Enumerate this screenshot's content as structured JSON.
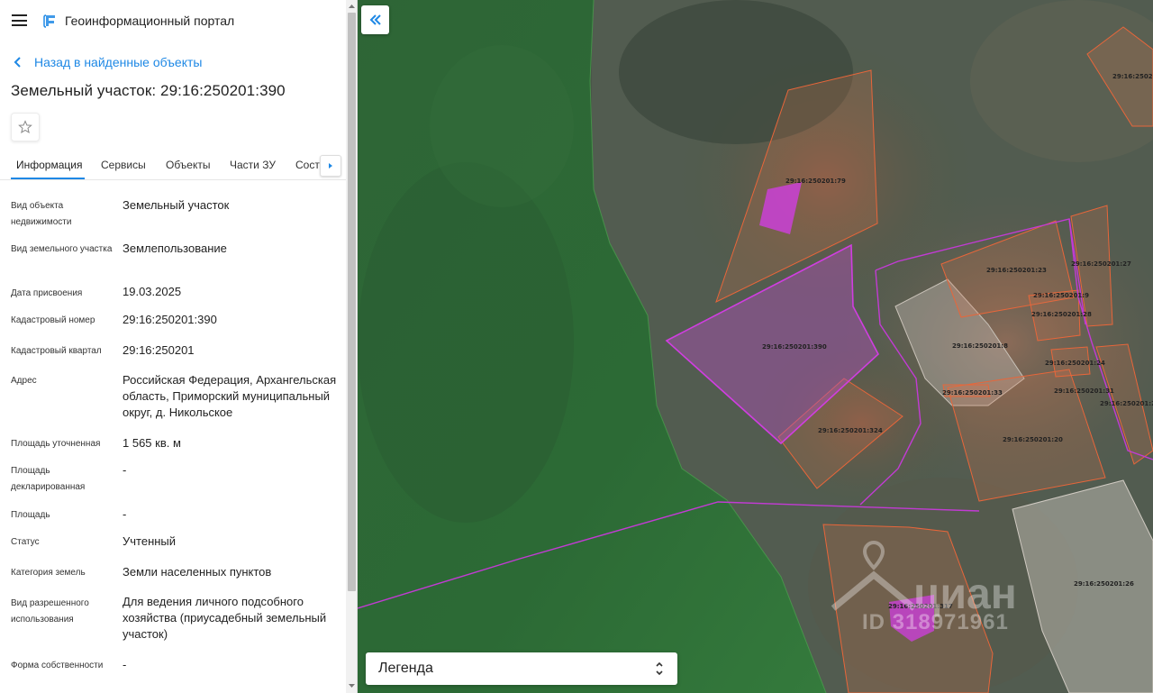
{
  "header": {
    "app_title": "Геоинформационный портал",
    "menu_icon": "hamburger-menu-icon",
    "logo_icon": "portal-logo-icon"
  },
  "nav": {
    "back_label": "Назад в найденные объекты"
  },
  "object": {
    "title": "Земельный участок: 29:16:250201:390"
  },
  "tabs": [
    {
      "label": "Информация",
      "active": true
    },
    {
      "label": "Сервисы",
      "active": false
    },
    {
      "label": "Объекты",
      "active": false
    },
    {
      "label": "Части ЗУ",
      "active": false
    },
    {
      "label": "Соста",
      "active": false
    }
  ],
  "properties": [
    {
      "label": "Вид объекта недвижимости",
      "value": "Земельный участок"
    },
    {
      "label": "Вид земельного участка",
      "value": "Землепользование"
    },
    {
      "label": "Дата присвоения",
      "value": "19.03.2025"
    },
    {
      "label": "Кадастровый номер",
      "value": "29:16:250201:390"
    },
    {
      "label": "Кадастровый квартал",
      "value": "29:16:250201"
    },
    {
      "label": "Адрес",
      "value": "Российская Федерация, Архангельская область, Приморский муниципальный округ, д. Никольское"
    },
    {
      "label": "Площадь уточненная",
      "value": "1 565 кв. м"
    },
    {
      "label": "Площадь декларированная",
      "value": "-"
    },
    {
      "label": "Площадь",
      "value": "-"
    },
    {
      "label": "Статус",
      "value": "Учтенный"
    },
    {
      "label": "Категория земель",
      "value": "Земли населенных пунктов"
    },
    {
      "label": "Вид разрешенного использования",
      "value": "Для ведения личного подсобного хозяйства (приусадебный земельный участок)"
    },
    {
      "label": "Форма собственности",
      "value": "-"
    }
  ],
  "map": {
    "legend_label": "Легенда",
    "parcels": [
      "29:16:250201:5",
      "29:16:250201:79",
      "29:16:250201:23",
      "29:16:250201:27",
      "29:16:250201:9",
      "29:16:250201:28",
      "29:16:250201:390",
      "29:16:250201:8",
      "29:16:250201:24",
      "29:16:250201:33",
      "29:16:250201:31",
      "29:16:250201:22",
      "29:16:250201:324",
      "29:16:250201:20",
      "29:16:250201:26",
      "29:16:250201:317"
    ],
    "watermark_brand": "циан",
    "watermark_id": "ID 318971961"
  },
  "colors": {
    "accent": "#1e88e5",
    "parcel_stroke": "#e8663a",
    "selected_parcel": "#c23bd4",
    "forest": "#2f6b36"
  }
}
